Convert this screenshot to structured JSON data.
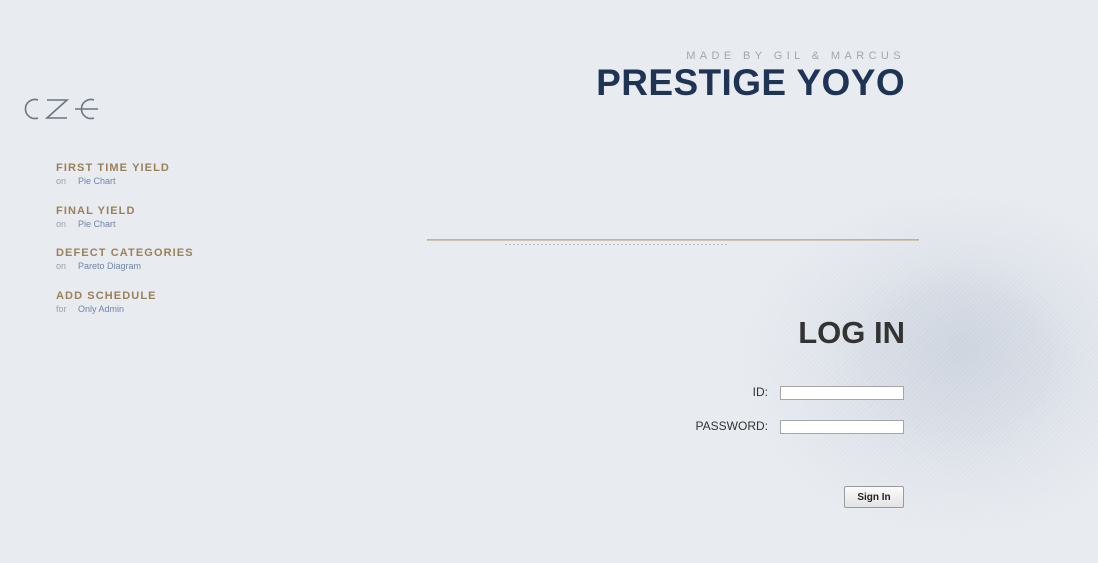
{
  "brand": {
    "logo_name": "cze-logo",
    "tagline": "MADE BY GIL & MARCUS",
    "title": "PRESTIGE YOYO"
  },
  "nav": {
    "items": [
      {
        "title": "FIRST TIME YIELD",
        "prefix": "on",
        "label": "Pie Chart"
      },
      {
        "title": "FINAL YIELD",
        "prefix": "on",
        "label": "Pie Chart"
      },
      {
        "title": "DEFECT CATEGORIES",
        "prefix": "on",
        "label": "Pareto Diagram"
      },
      {
        "title": "ADD SCHEDULE",
        "prefix": "for",
        "label": "Only Admin"
      }
    ]
  },
  "login": {
    "heading": "LOG IN",
    "id_label": "ID:",
    "id_value": "",
    "password_label": "PASSWORD:",
    "password_value": "",
    "submit_label": "Sign In"
  },
  "colors": {
    "background": "#e8ebf0",
    "brand_title": "#1f3354",
    "nav_title": "#9a8158",
    "nav_link": "#6f86a6",
    "tagline": "#a2a7ad"
  }
}
